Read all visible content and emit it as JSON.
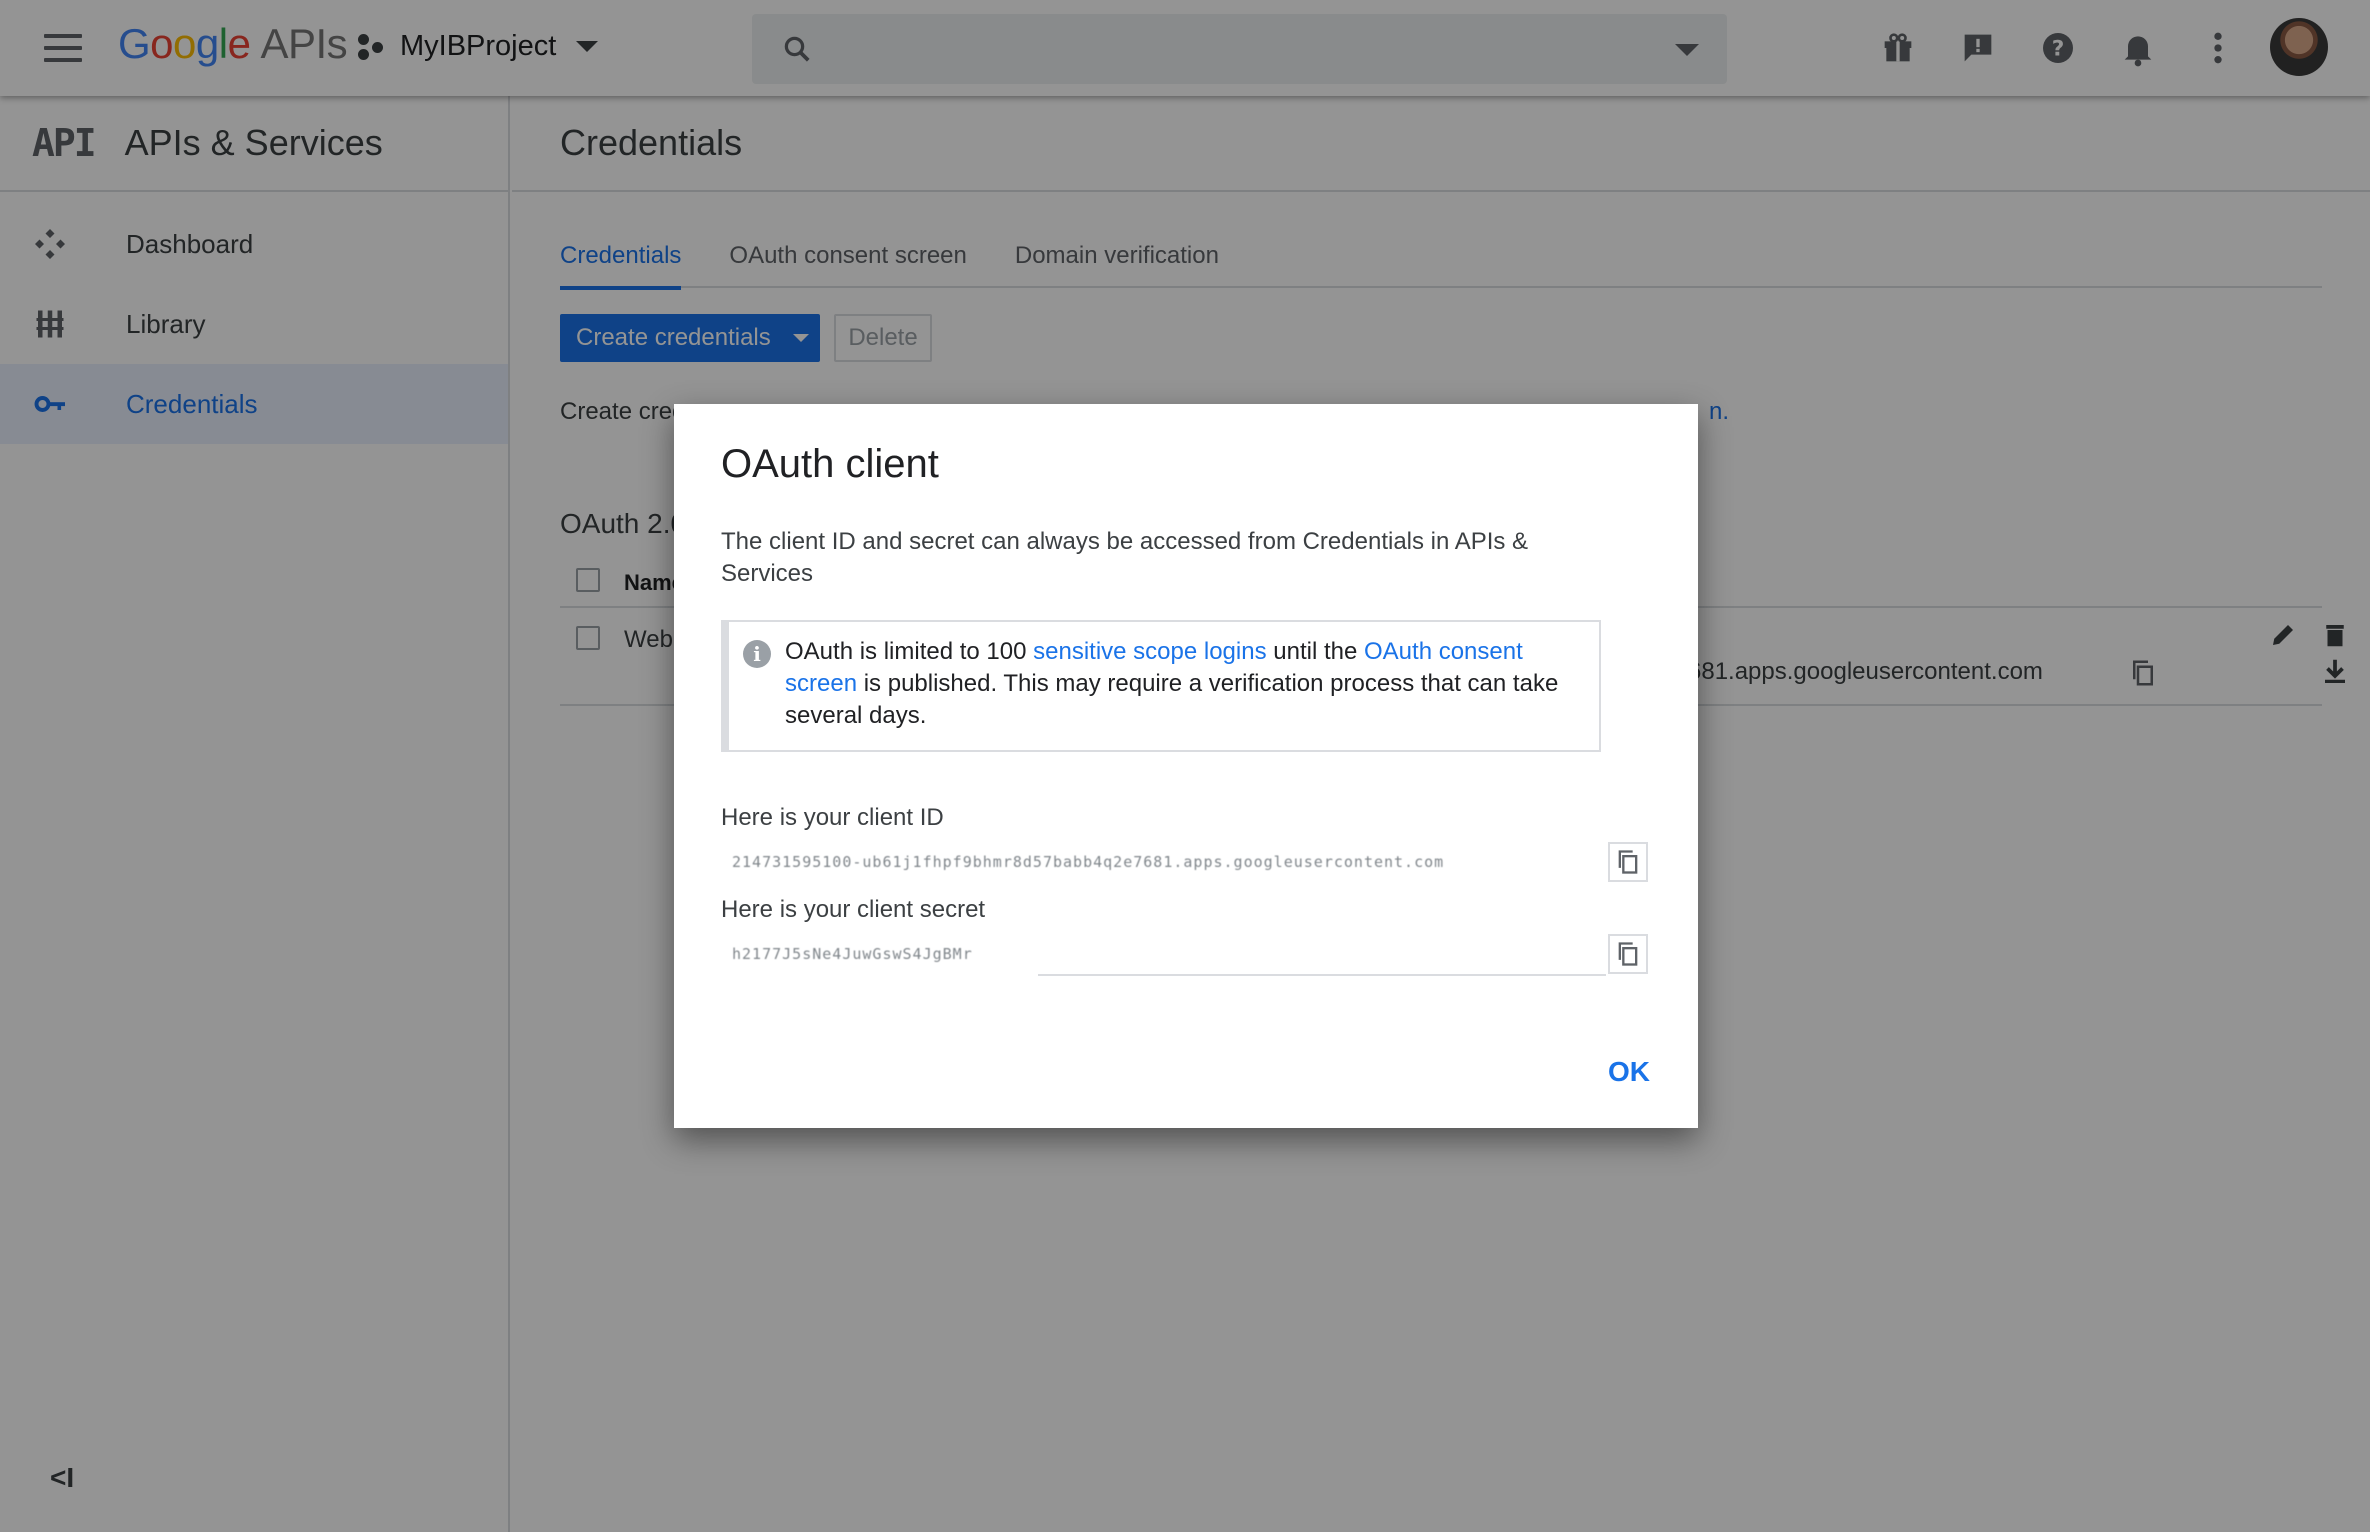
{
  "topbar": {
    "logo_google": [
      "G",
      "o",
      "o",
      "g",
      "l",
      "e"
    ],
    "logo_apis": "APIs",
    "project_name": "MyIBProject",
    "search_placeholder": ""
  },
  "sidebar": {
    "logo": "API",
    "title": "APIs & Services",
    "items": [
      {
        "label": "Dashboard",
        "icon": "dashboard-icon",
        "active": false
      },
      {
        "label": "Library",
        "icon": "library-icon",
        "active": false
      },
      {
        "label": "Credentials",
        "icon": "key-icon",
        "active": true
      }
    ],
    "collapse_label": "<I"
  },
  "main": {
    "title": "Credentials",
    "tabs": [
      {
        "label": "Credentials",
        "active": true
      },
      {
        "label": "OAuth consent screen",
        "active": false
      },
      {
        "label": "Domain verification",
        "active": false
      }
    ],
    "create_button": "Create credentials",
    "delete_button": "Delete",
    "intro_text": "Create crec",
    "intro_link_tail": "n.",
    "section_title": "OAuth 2.0",
    "table_header_name": "Name",
    "row": {
      "name": "Web",
      "client_id_tail": "681.apps.googleusercontent.com"
    }
  },
  "dialog": {
    "title": "OAuth client",
    "description": "The client ID and secret can always be accessed from Credentials in APIs & Services",
    "notice": {
      "part1": "OAuth is limited to 100 ",
      "link1": "sensitive scope logins",
      "part2": " until the ",
      "link2": "OAuth consent screen",
      "part3": " is published. This may require a verification process that can take several days."
    },
    "client_id_label": "Here is your client ID",
    "client_id_value": "214731595100-ub61j1fhpf9bhmr8d57babb4q2e7681.apps.googleusercontent.com",
    "client_secret_label": "Here is your client secret",
    "client_secret_value": "h2177J5sNe4JuwGswS4JgBMr",
    "ok_button": "OK"
  },
  "colors": {
    "accent": "#1a73e8",
    "active_nav_bg": "#e8f0fe",
    "scrim": "rgba(0,0,0,0.42)"
  }
}
